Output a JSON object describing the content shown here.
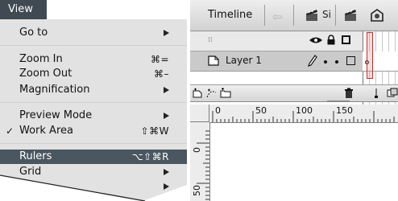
{
  "menu": {
    "title": "View",
    "items": [
      {
        "label": "Go to",
        "shortcut": "",
        "submenu": true,
        "checked": false,
        "highlighted": false
      },
      {
        "label": "Zoom In",
        "shortcut": "⌘=",
        "submenu": false,
        "checked": false,
        "highlighted": false
      },
      {
        "label": "Zoom Out",
        "shortcut": "⌘–",
        "submenu": false,
        "checked": false,
        "highlighted": false
      },
      {
        "label": "Magnification",
        "shortcut": "",
        "submenu": true,
        "checked": false,
        "highlighted": false
      },
      {
        "label": "Preview Mode",
        "shortcut": "",
        "submenu": true,
        "checked": false,
        "highlighted": false
      },
      {
        "label": "Work Area",
        "shortcut": "⇧⌘W",
        "submenu": false,
        "checked": true,
        "highlighted": false
      },
      {
        "label": "Rulers",
        "shortcut": "⌥⇧⌘R",
        "submenu": false,
        "checked": false,
        "highlighted": true
      },
      {
        "label": "Grid",
        "shortcut": "",
        "submenu": true,
        "checked": false,
        "highlighted": false
      },
      {
        "label": "",
        "shortcut": "",
        "submenu": true,
        "checked": false,
        "highlighted": false
      }
    ],
    "check_mark": "✓"
  },
  "timeline": {
    "title": "Timeline",
    "scene_label": "Si",
    "back_arrow": "⇦",
    "frame_number": "1",
    "layer": {
      "name": "Layer 1"
    },
    "icons": [
      "eye-icon",
      "lock-icon",
      "outline-icon",
      "pencil-icon",
      "add-layer-icon",
      "add-motion-guide-icon",
      "add-folder-icon",
      "trash-icon"
    ]
  },
  "rulers": {
    "horizontal": [
      "0",
      "50",
      "100",
      "150"
    ],
    "vertical": [
      "0",
      "50"
    ]
  },
  "colors": {
    "menu_bg": "#e2e2e2",
    "highlight": "#4a5660",
    "title_bar": "#3f4a52"
  }
}
